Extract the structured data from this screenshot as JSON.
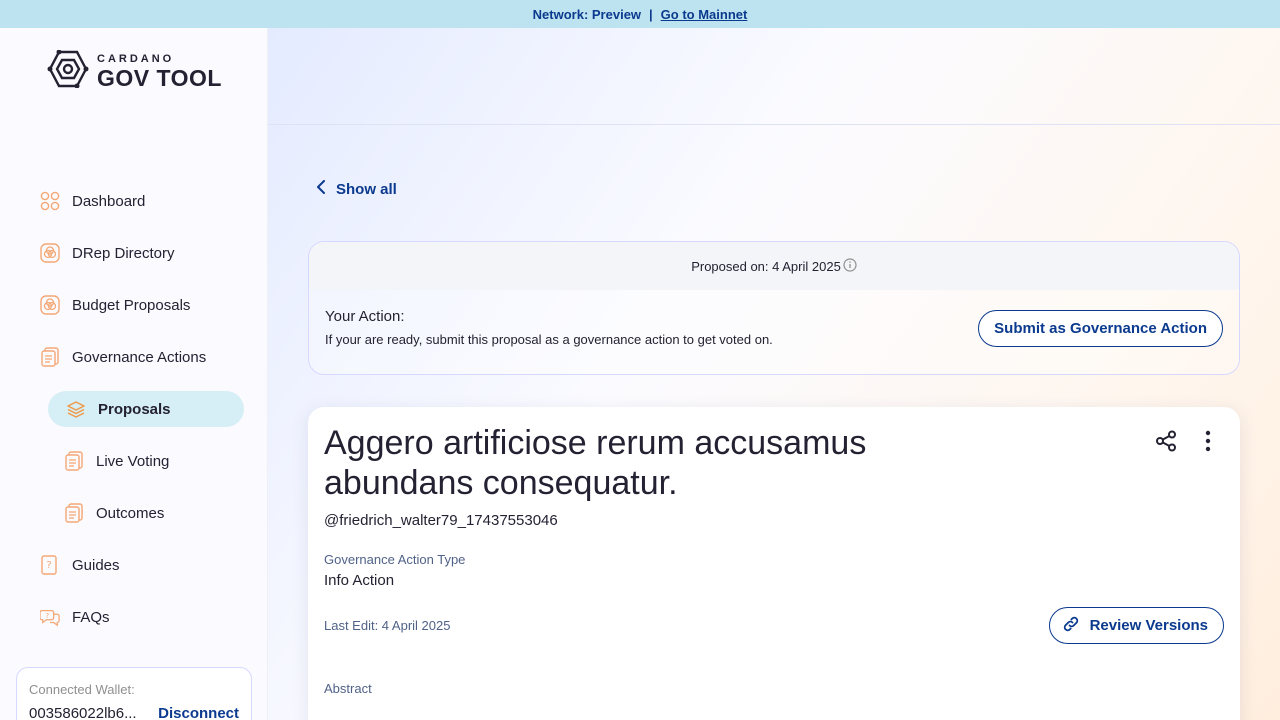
{
  "banner": {
    "network": "Network: Preview",
    "separator": "|",
    "link": "Go to Mainnet"
  },
  "logo": {
    "small": "CARDANO",
    "big": "GOV TOOL"
  },
  "sidebar": {
    "items": [
      {
        "label": "Dashboard",
        "icon": "dashboard-icon"
      },
      {
        "label": "DRep Directory",
        "icon": "drep-icon"
      },
      {
        "label": "Budget Proposals",
        "icon": "budget-icon"
      },
      {
        "label": "Governance Actions",
        "icon": "document-icon"
      },
      {
        "label": "Proposals",
        "icon": "layers-icon",
        "active": true
      },
      {
        "label": "Live Voting",
        "icon": "document-icon"
      },
      {
        "label": "Outcomes",
        "icon": "document-icon"
      },
      {
        "label": "Guides",
        "icon": "guide-icon"
      },
      {
        "label": "FAQs",
        "icon": "faq-icon"
      }
    ]
  },
  "wallet": {
    "label": "Connected Wallet:",
    "address": "003586022lb6...",
    "disconnect": "Disconnect"
  },
  "main": {
    "show_all": "Show all",
    "action_card": {
      "proposed_on": "Proposed on: 4 April 2025",
      "your_action": "Your Action:",
      "description": "If your are ready, submit this proposal as a governance action to get voted on.",
      "submit_label": "Submit as Governance Action"
    },
    "proposal": {
      "title": "Aggero artificiose rerum accusamus abundans consequatur.",
      "author": "@friedrich_walter79_17437553046",
      "type_label": "Governance Action Type",
      "type_value": "Info Action",
      "last_edit": "Last Edit: 4 April 2025",
      "review_label": "Review Versions",
      "abstract_label": "Abstract"
    }
  },
  "colors": {
    "accent": "#0b3a8e",
    "banner": "#bde3f0",
    "active_nav": "#d6eef5",
    "icon_orange": "#f4a876"
  }
}
